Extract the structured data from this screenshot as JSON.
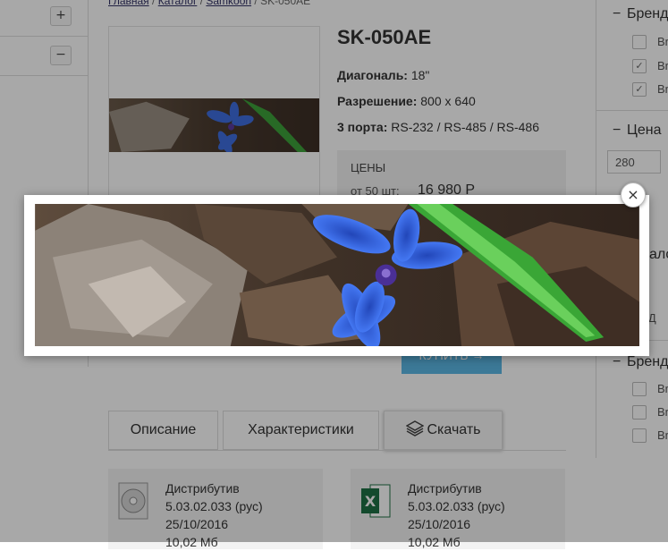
{
  "breadcrumb": {
    "items": [
      "Главная",
      "Каталог",
      "Samkoon"
    ],
    "current": "SK-050AE",
    "separator": "/"
  },
  "left_panel": {
    "rows": [
      {
        "toggle": "+"
      },
      {
        "toggle": "−"
      }
    ]
  },
  "product": {
    "title": "SK-050AE",
    "specs": [
      {
        "label": "Диагональ:",
        "value": "18\""
      },
      {
        "label": "Разрешение:",
        "value": "800 х 640"
      },
      {
        "label": "3 порта:",
        "value": "RS-232 / RS-485 / RS-486"
      }
    ],
    "prices_heading": "ЦЕНЫ",
    "price_from": "от 50 шт:",
    "price_value": "16 980 Р",
    "buy_label": "КУПИТЬ →"
  },
  "tabs": [
    {
      "label": "Описание",
      "active": false
    },
    {
      "label": "Характеристики",
      "active": false
    },
    {
      "label": "Скачать",
      "active": true,
      "icon": "layers-icon"
    }
  ],
  "downloads": [
    {
      "icon": "disc-icon",
      "title": "Дистрибутив",
      "version": "5.03.02.033 (рус)",
      "date": "25/10/2016",
      "size": "10,02 Мб"
    },
    {
      "icon": "excel-icon",
      "title": "Дистрибутив",
      "version": "5.03.02.033 (рус)",
      "date": "25/10/2016",
      "size": "10,02 Мб"
    }
  ],
  "right_panel": {
    "filter1": {
      "heading": "Бренд",
      "options": [
        {
          "label": "Br",
          "checked": false
        },
        {
          "label": "Br",
          "checked": true
        },
        {
          "label": "Br",
          "checked": true
        }
      ]
    },
    "price_filter": {
      "heading": "Цена",
      "min_value": "280"
    },
    "partial_labels": [
      "Каталог",
      "без Д"
    ],
    "filter2": {
      "heading": "Бренд",
      "options": [
        {
          "label": "Br",
          "checked": false
        },
        {
          "label": "Br",
          "checked": false
        },
        {
          "label": "Br",
          "checked": false
        }
      ]
    }
  },
  "lightbox": {
    "close_label": "×",
    "image": "blue-flower-photo"
  },
  "colors": {
    "overlay": "rgba(0,0,0,0.34)",
    "buy_button": "#5cb8e6",
    "flower_blue": "#3f6ee0"
  }
}
